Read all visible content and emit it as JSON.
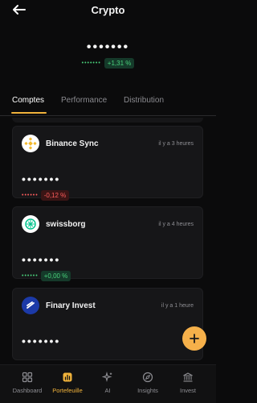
{
  "header": {
    "title": "Crypto"
  },
  "summary": {
    "balance_masked": "•••••••",
    "change_masked": "•••••••",
    "change": "+1,31 %"
  },
  "tabs": [
    {
      "label": "Comptes"
    },
    {
      "label": "Performance"
    },
    {
      "label": "Distribution"
    }
  ],
  "accounts": [
    {
      "name": "Binance Sync",
      "updated": "il y a 3 heures",
      "balance_masked": "•••••••",
      "change_masked": "••••••",
      "change": "-0,12 %"
    },
    {
      "name": "swissborg",
      "updated": "il y a 4 heures",
      "balance_masked": "•••••••",
      "change_masked": "••••••",
      "change": "+0,00 %"
    },
    {
      "name": "Finary Invest",
      "updated": "il y a 1 heure",
      "balance_masked": "•••••••"
    }
  ],
  "nav": [
    {
      "label": "Dashboard"
    },
    {
      "label": "Portefeuille"
    },
    {
      "label": "AI"
    },
    {
      "label": "Insights"
    },
    {
      "label": "Invest"
    }
  ],
  "colors": {
    "accent": "#f0b23b",
    "positive": "#49d17b",
    "negative": "#ff5d5d",
    "fab": "#f5b04a"
  },
  "icons": {
    "back": "arrow-left-icon",
    "fab": "plus-icon",
    "nav": [
      "grid-icon",
      "portfolio-icon",
      "sparkle-icon",
      "compass-icon",
      "bank-icon"
    ]
  }
}
